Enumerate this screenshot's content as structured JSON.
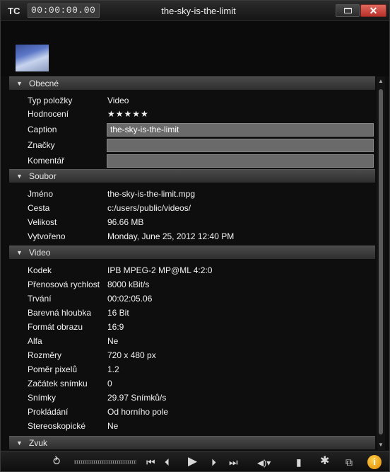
{
  "titlebar": {
    "tc_label": "TC",
    "timecode": "00:00:00.00",
    "title": "the-sky-is-the-limit",
    "close_label": "✕"
  },
  "sections": {
    "general": {
      "label": "Obecné",
      "rows": {
        "type": {
          "key": "Typ položky",
          "value": "Video"
        },
        "rating": {
          "key": "Hodnocení",
          "value": "★★★★★"
        },
        "caption": {
          "key": "Caption",
          "value": "the-sky-is-the-limit"
        },
        "tags": {
          "key": "Značky",
          "value": ""
        },
        "comment": {
          "key": "Komentář",
          "value": ""
        }
      }
    },
    "file": {
      "label": "Soubor",
      "rows": {
        "name": {
          "key": "Jméno",
          "value": "the-sky-is-the-limit.mpg"
        },
        "path": {
          "key": "Cesta",
          "value": "c:/users/public/videos/"
        },
        "size": {
          "key": "Velikost",
          "value": "96.66 MB"
        },
        "created": {
          "key": "Vytvořeno",
          "value": "Monday, June 25, 2012 12:40 PM"
        }
      }
    },
    "video": {
      "label": "Video",
      "rows": {
        "codec": {
          "key": "Kodek",
          "value": "IPB MPEG-2  MP@ML 4:2:0"
        },
        "bitrate": {
          "key": "Přenosová rychlost",
          "value": "8000 kBit/s"
        },
        "duration": {
          "key": "Trvání",
          "value": "00:02:05.06"
        },
        "depth": {
          "key": "Barevná hloubka",
          "value": "16 Bit"
        },
        "aspect": {
          "key": "Formát obrazu",
          "value": "16:9"
        },
        "alpha": {
          "key": "Alfa",
          "value": "Ne"
        },
        "dims": {
          "key": "Rozměry",
          "value": "720 x 480 px"
        },
        "par": {
          "key": "Poměr pixelů",
          "value": "1.2"
        },
        "start": {
          "key": "Začátek snímku",
          "value": "0"
        },
        "fps": {
          "key": "Snímky",
          "value": "29.97 Snímků/s"
        },
        "interlace": {
          "key": "Prokládání",
          "value": "Od horního pole"
        },
        "stereo": {
          "key": "Stereoskopické",
          "value": "Ne"
        }
      }
    },
    "audio": {
      "label": "Zvuk"
    }
  },
  "toolbar": {
    "loop_icon": "loop-icon",
    "first_icon": "skip-to-start-icon",
    "prev_icon": "previous-frame-icon",
    "play_icon": "play-icon",
    "next_icon": "next-frame-icon",
    "last_icon": "skip-to-end-icon",
    "volume_icon": "volume-icon",
    "copy_icon": "copy-icon",
    "settings_icon": "gear-icon",
    "external_icon": "external-view-icon",
    "info_label": "i"
  },
  "colors": {
    "background": "#0e0e0e",
    "section_header": "#3a3a3a",
    "field": "#6a6a6a",
    "info_accent": "#f0a000",
    "close_button": "#c8453a"
  }
}
